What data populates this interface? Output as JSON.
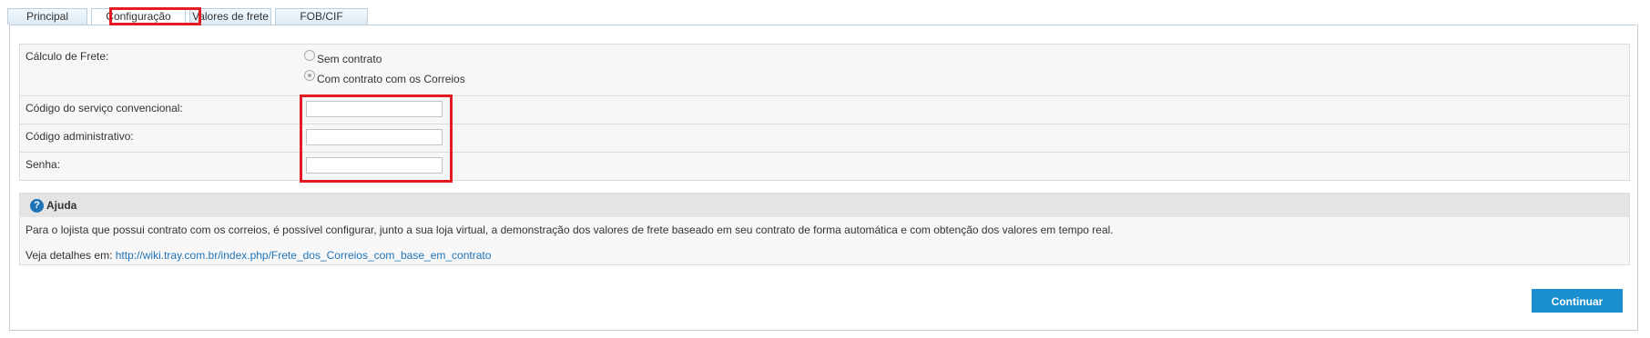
{
  "tabs": [
    "Principal",
    "Configuração",
    "Valores de frete",
    "FOB/CIF"
  ],
  "active_tab": "Configuração",
  "form": {
    "calculo_label": "Cálculo de Frete:",
    "option_sem_contrato": "Sem contrato",
    "option_com_contrato": "Com contrato com os Correios",
    "selected_option": "Com contrato com os Correios",
    "codigo_servico_label": "Código do serviço convencional:",
    "codigo_servico_value": "",
    "codigo_admin_label": "Código administrativo:",
    "codigo_admin_value": "",
    "senha_label": "Senha:",
    "senha_value": ""
  },
  "help": {
    "icon": "question-circle-icon",
    "title": "Ajuda",
    "text": "Para o lojista que possui contrato com os correios, é possível configurar, junto a sua loja virtual, a demonstração dos valores de frete baseado em seu contrato de forma automática e com obtenção dos valores em tempo real.",
    "details_label": "Veja detalhes em:",
    "link": "http://wiki.tray.com.br/index.php/Frete_dos_Correios_com_base_em_contrato"
  },
  "continue_button": "Continuar",
  "colors": {
    "accent": "#1a8fd0",
    "highlight": "#e31b23",
    "link": "#1f73b7"
  }
}
